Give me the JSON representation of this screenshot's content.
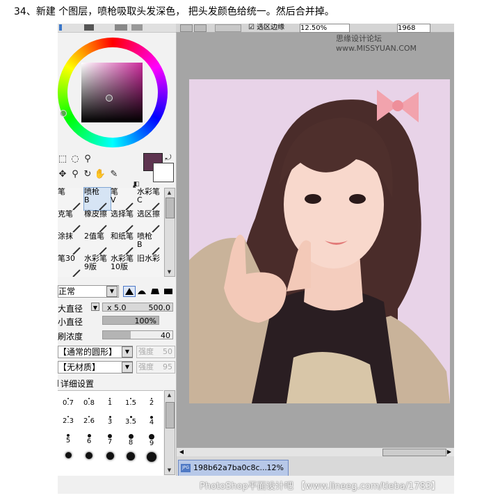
{
  "caption": "34、新建 个图层，喷枪吸取头发深色， 把头发颜色给统一。然后合并掉。",
  "colors": {
    "foreground": "#5e3450",
    "background": "#ffffff",
    "canvas_bg": "#e8d3e8"
  },
  "brushes": [
    {
      "label": "笔",
      "sub": ""
    },
    {
      "label": "喷枪",
      "sub": "B"
    },
    {
      "label": "笔",
      "sub": "V"
    },
    {
      "label": "水彩笔",
      "sub": "C"
    },
    {
      "label": "克笔",
      "sub": ""
    },
    {
      "label": "橡皮擦",
      "sub": ""
    },
    {
      "label": "选择笔",
      "sub": ""
    },
    {
      "label": "选区擦",
      "sub": ""
    },
    {
      "label": "涂抹",
      "sub": ""
    },
    {
      "label": "2值笔",
      "sub": ""
    },
    {
      "label": "和纸笔",
      "sub": ""
    },
    {
      "label": "喷枪",
      "sub": "B"
    },
    {
      "label": "笔30",
      "sub": ""
    },
    {
      "label": "水彩笔",
      "sub": "9版"
    },
    {
      "label": "水彩笔",
      "sub": "10版"
    },
    {
      "label": "旧水彩",
      "sub": ""
    }
  ],
  "blend_mode": "正常",
  "params": {
    "max_diameter_label": "大直径",
    "max_diameter_multiplier": "x 5.0",
    "max_diameter_value": "500.0",
    "min_diameter_label": "小直径",
    "min_diameter_value": "100%",
    "density_label": "刷浓度",
    "density_value": "40",
    "density_fraction": 0.4
  },
  "shape_combo": "【通常的圆形】",
  "shape_strength_label": "强度",
  "shape_strength_value": "50",
  "texture_combo": "【无材质】",
  "texture_strength_label": "强度",
  "texture_strength_value": "95",
  "detail_settings": "详细设置",
  "brush_sizes": [
    "0.7",
    "0.8",
    "1",
    "1.5",
    "2",
    "2.3",
    "2.6",
    "3",
    "3.5",
    "4",
    "5",
    "6",
    "7",
    "8",
    "9",
    "",
    "",
    "",
    "",
    ""
  ],
  "toolbar_zoom": "12.50%",
  "toolbar_right": "1968",
  "toolbar_select_label": "选区边缘",
  "watermark_top": "思缘设计论坛 www.MISSYUAN.COM",
  "document": {
    "name": "198b62a7ba0c8c...",
    "zoom": "12%"
  },
  "watermark_bottom": "PhotoShop平面设计吧 【www.lineeg.com/tieba/1783】"
}
